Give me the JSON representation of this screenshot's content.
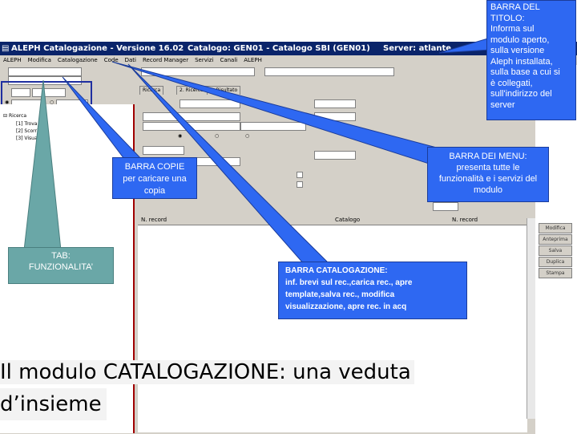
{
  "window": {
    "title_app": "ALEPH Catalogazione - Versione 16.02",
    "title_catalog": "Catalogo:  GEN01 - Catalogo SBI (GEN01)",
    "title_server": "Server:  atlante"
  },
  "menu": {
    "items": [
      "ALEPH",
      "Modifica",
      "Catalogazione",
      "Code",
      "Dati",
      "Record Manager",
      "Servizi",
      "Canali",
      "ALEPH"
    ]
  },
  "tabs": [
    "Ricerca",
    "2. Ricerca CCL",
    "3. Risultato"
  ],
  "right_buttons": [
    "Modifica",
    "Anteprima",
    "Salva",
    "Duplica",
    "Stampa"
  ],
  "list_headers": {
    "col1": "N. record",
    "col2": "Catalogo",
    "col3": "N. record"
  },
  "tree": {
    "root": "Ricerca",
    "items": [
      "[1] Trova",
      "[2] Scorri",
      "[3] Visualizza"
    ]
  },
  "callouts": {
    "title_bar": "BARRA DEL TITOLO: Informa sul modulo aperto, sulla versione Aleph installata, sulla base a cui si è collegati, sull'indirizzo del server",
    "title_bar_lines": [
      "BARRA DEL",
      "TITOLO:",
      "Informa sul",
      "modulo aperto,",
      "sulla versione",
      "Aleph installata,",
      "sulla base a cui si",
      "è collegati,",
      "sull'indirizzo del",
      "server"
    ],
    "menu_bar_lines": [
      "BARRA DEI MENU:",
      "presenta tutte le",
      "funzionalità e i servizi del",
      "modulo"
    ],
    "copy_bar_lines": [
      "BARRA COPIE",
      "per caricare una",
      "copia"
    ],
    "tab_lines": [
      "TAB:",
      "FUNZIONALITA’"
    ],
    "cat_bar_lines": [
      "BARRA CATALOGAZIONE:",
      "inf. brevi sul rec.,carica rec., apre",
      "template,salva rec., modifica",
      "visualizzazione, apre rec. in acq"
    ]
  },
  "caption": {
    "line1": "Il modulo CATALOGAZIONE: una veduta",
    "line2": "d’insieme"
  },
  "colors": {
    "titlebar": "#0a246a",
    "callout_blue": "#2e68f2",
    "callout_teal": "#6aa7a7",
    "window_gray": "#d4d0c8",
    "highlight_frame": "#1f2fa0"
  }
}
